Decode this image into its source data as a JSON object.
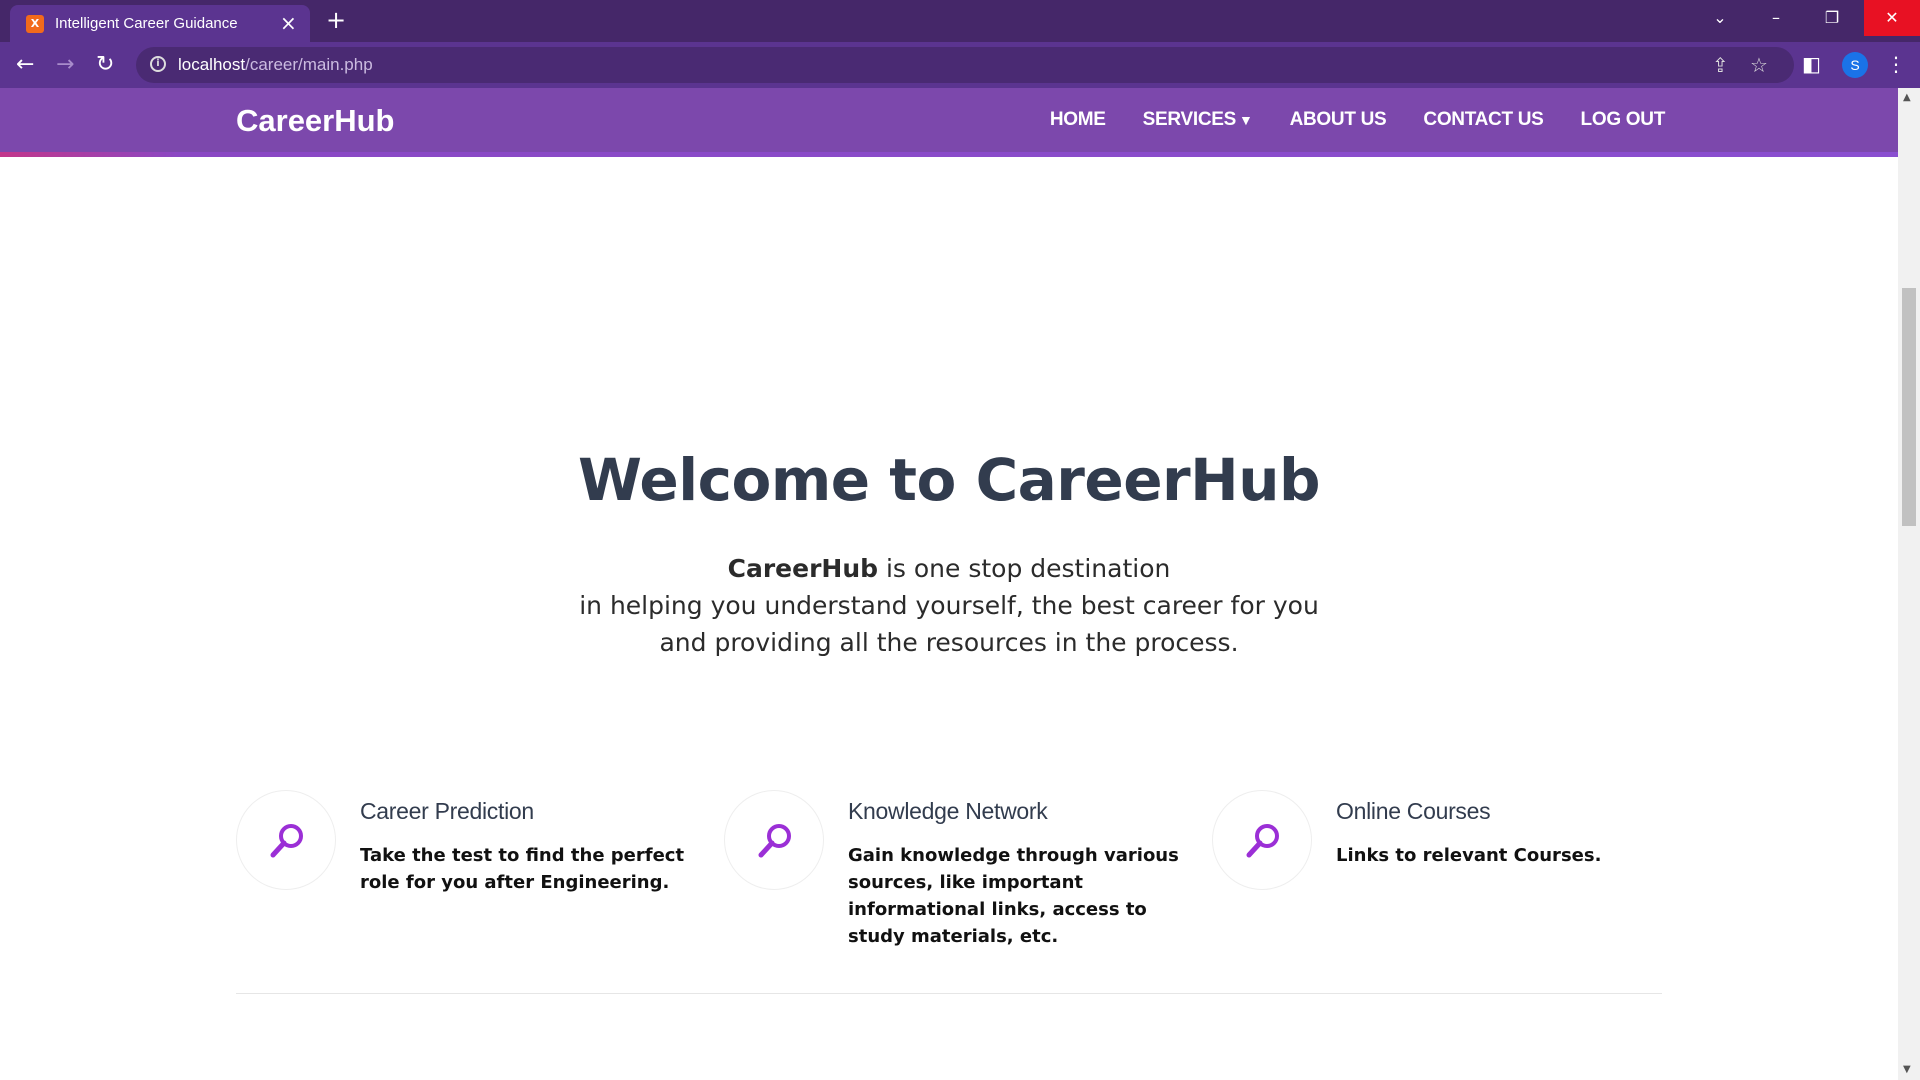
{
  "browser": {
    "tab_title": "Intelligent Career Guidance",
    "tab_favicon": "X",
    "url_host": "localhost",
    "url_path": "/career/main.php",
    "profile_initial": "S"
  },
  "nav": {
    "brand": "CareerHub",
    "items": [
      "HOME",
      "SERVICES",
      "ABOUT US",
      "CONTACT US",
      "LOG OUT"
    ]
  },
  "hero": {
    "title": "Welcome to CareerHub",
    "brand_bold": "CareerHub",
    "line1_rest": " is one stop destination",
    "line2": "in helping you understand yourself, the best career for you",
    "line3": "and providing all the resources in the process."
  },
  "features": [
    {
      "title": "Career Prediction",
      "desc": "Take the test to find the perfect role for you after Engineering.",
      "icon": "magnifier-icon"
    },
    {
      "title": "Knowledge Network",
      "desc": "Gain knowledge through various sources, like important informational links, access to study materials, etc.",
      "icon": "magnifier-icon"
    },
    {
      "title": "Online Courses",
      "desc": "Links to relevant Courses.",
      "icon": "magnifier-icon"
    }
  ],
  "colors": {
    "navbar": "#7c48ac",
    "accent": "#9b2fd6",
    "heading": "#323c4e"
  }
}
